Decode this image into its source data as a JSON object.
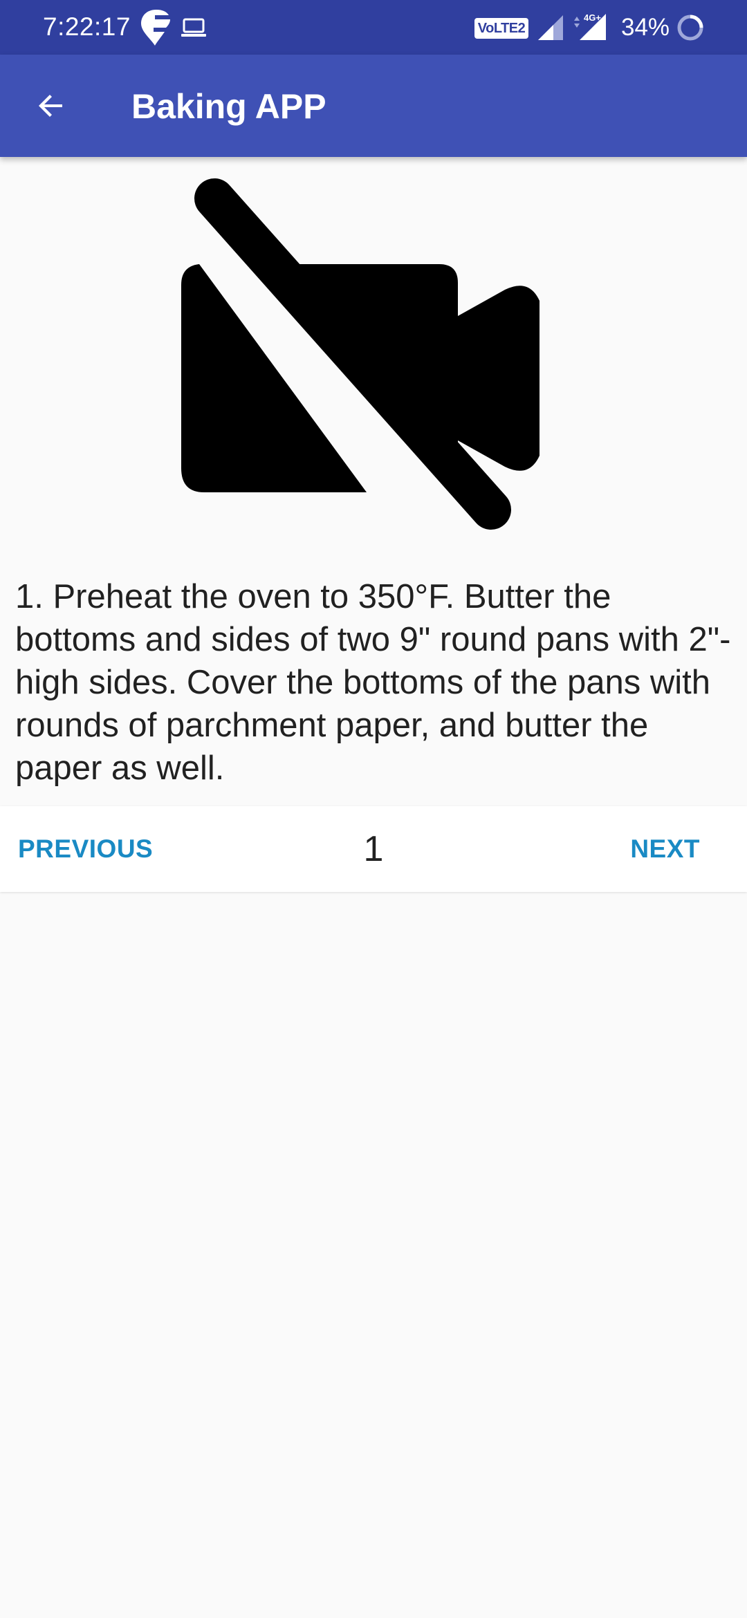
{
  "status_bar": {
    "time": "7:22:17",
    "network_badge": "VoLTE2",
    "network_type": "4G+",
    "battery": "34%"
  },
  "app_bar": {
    "title": "Baking APP",
    "back_icon": "arrow-back-icon"
  },
  "video": {
    "placeholder_icon": "videocam-off-icon"
  },
  "step": {
    "description": "1. Preheat the oven to 350°F. Butter the bottoms and sides of two 9\" round pans with 2\"-high sides. Cover the bottoms of the pans with rounds of parchment paper, and butter the paper as well."
  },
  "navigation": {
    "previous_label": "PREVIOUS",
    "step_number": "1",
    "next_label": "NEXT"
  },
  "colors": {
    "status_bar": "#303f9f",
    "app_bar": "#3f51b5",
    "accent": "#1a8ac4",
    "background": "#fafafa"
  }
}
